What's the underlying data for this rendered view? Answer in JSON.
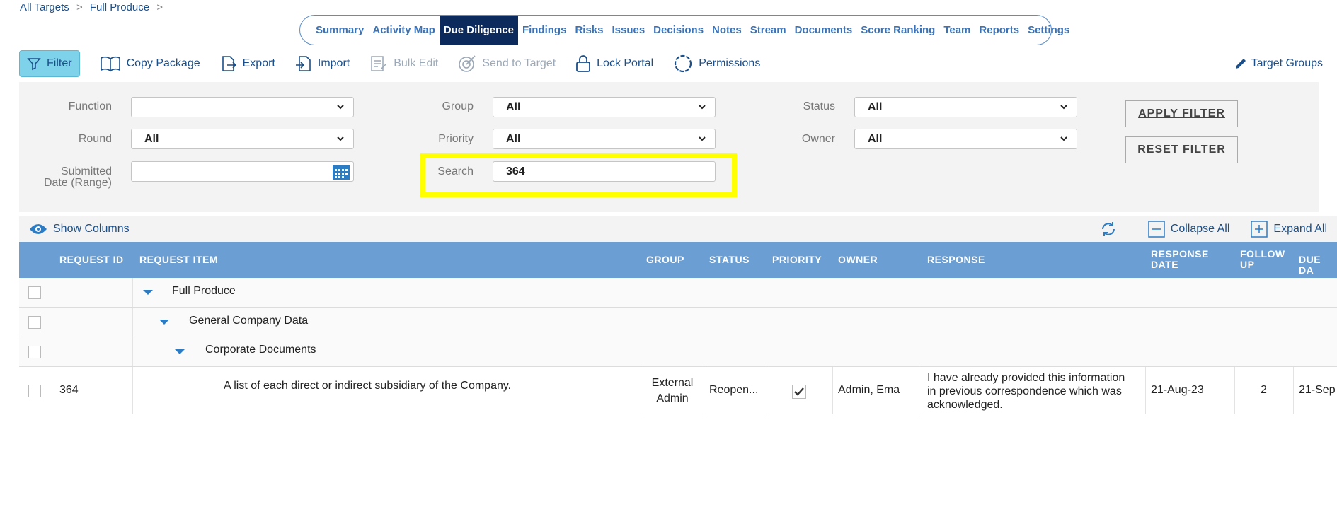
{
  "breadcrumb": {
    "root": "All Targets",
    "sep": ">",
    "current": "Full Produce",
    "trail": ">"
  },
  "nav": {
    "tabs": [
      "Summary",
      "Activity Map",
      "Due Diligence",
      "Findings",
      "Risks",
      "Issues",
      "Decisions",
      "Notes",
      "Stream",
      "Documents",
      "Score Ranking",
      "Team",
      "Reports",
      "Settings"
    ],
    "active": "Due Diligence"
  },
  "toolbar": {
    "filter": "Filter",
    "copy_package": "Copy Package",
    "export": "Export",
    "import": "Import",
    "bulk_edit": "Bulk Edit",
    "send_to_target": "Send to Target",
    "lock_portal": "Lock Portal",
    "permissions": "Permissions",
    "target_groups": "Target Groups"
  },
  "filters": {
    "function_label": "Function",
    "function_value": "",
    "round_label": "Round",
    "round_value": "All",
    "submitted_label_1": "Submitted",
    "submitted_label_2": "Date (Range)",
    "submitted_value": "",
    "group_label": "Group",
    "group_value": "All",
    "priority_label": "Priority",
    "priority_value": "All",
    "search_label": "Search",
    "search_value": "364",
    "status_label": "Status",
    "status_value": "All",
    "owner_label": "Owner",
    "owner_value": "All",
    "apply": "APPLY FILTER",
    "reset": "RESET FILTER"
  },
  "columns_bar": {
    "show_columns": "Show Columns",
    "collapse_all": "Collapse All",
    "expand_all": "Expand All"
  },
  "table": {
    "headers": {
      "request_id": "REQUEST ID",
      "request_item": "REQUEST ITEM",
      "group": "GROUP",
      "status": "STATUS",
      "priority": "PRIORITY",
      "owner": "OWNER",
      "response": "RESPONSE",
      "response_date_1": "RESPONSE",
      "response_date_2": "DATE",
      "follow_up_1": "FOLLOW",
      "follow_up_2": "UP",
      "due_date": "DUE DA"
    },
    "tree": [
      "Full Produce",
      "General Company Data",
      "Corporate Documents"
    ],
    "row": {
      "id": "364",
      "item": "A list of each direct or indirect subsidiary of the Company.",
      "group_1": "External",
      "group_2": "Admin",
      "status": "Reopen...",
      "owner": "Admin, Ema",
      "response_1": "I have already provided this information",
      "response_2": "in previous correspondence which was",
      "response_3": "acknowledged.",
      "response_date": "21-Aug-23",
      "follow_up": "2",
      "due_date": "21-Sep"
    }
  }
}
